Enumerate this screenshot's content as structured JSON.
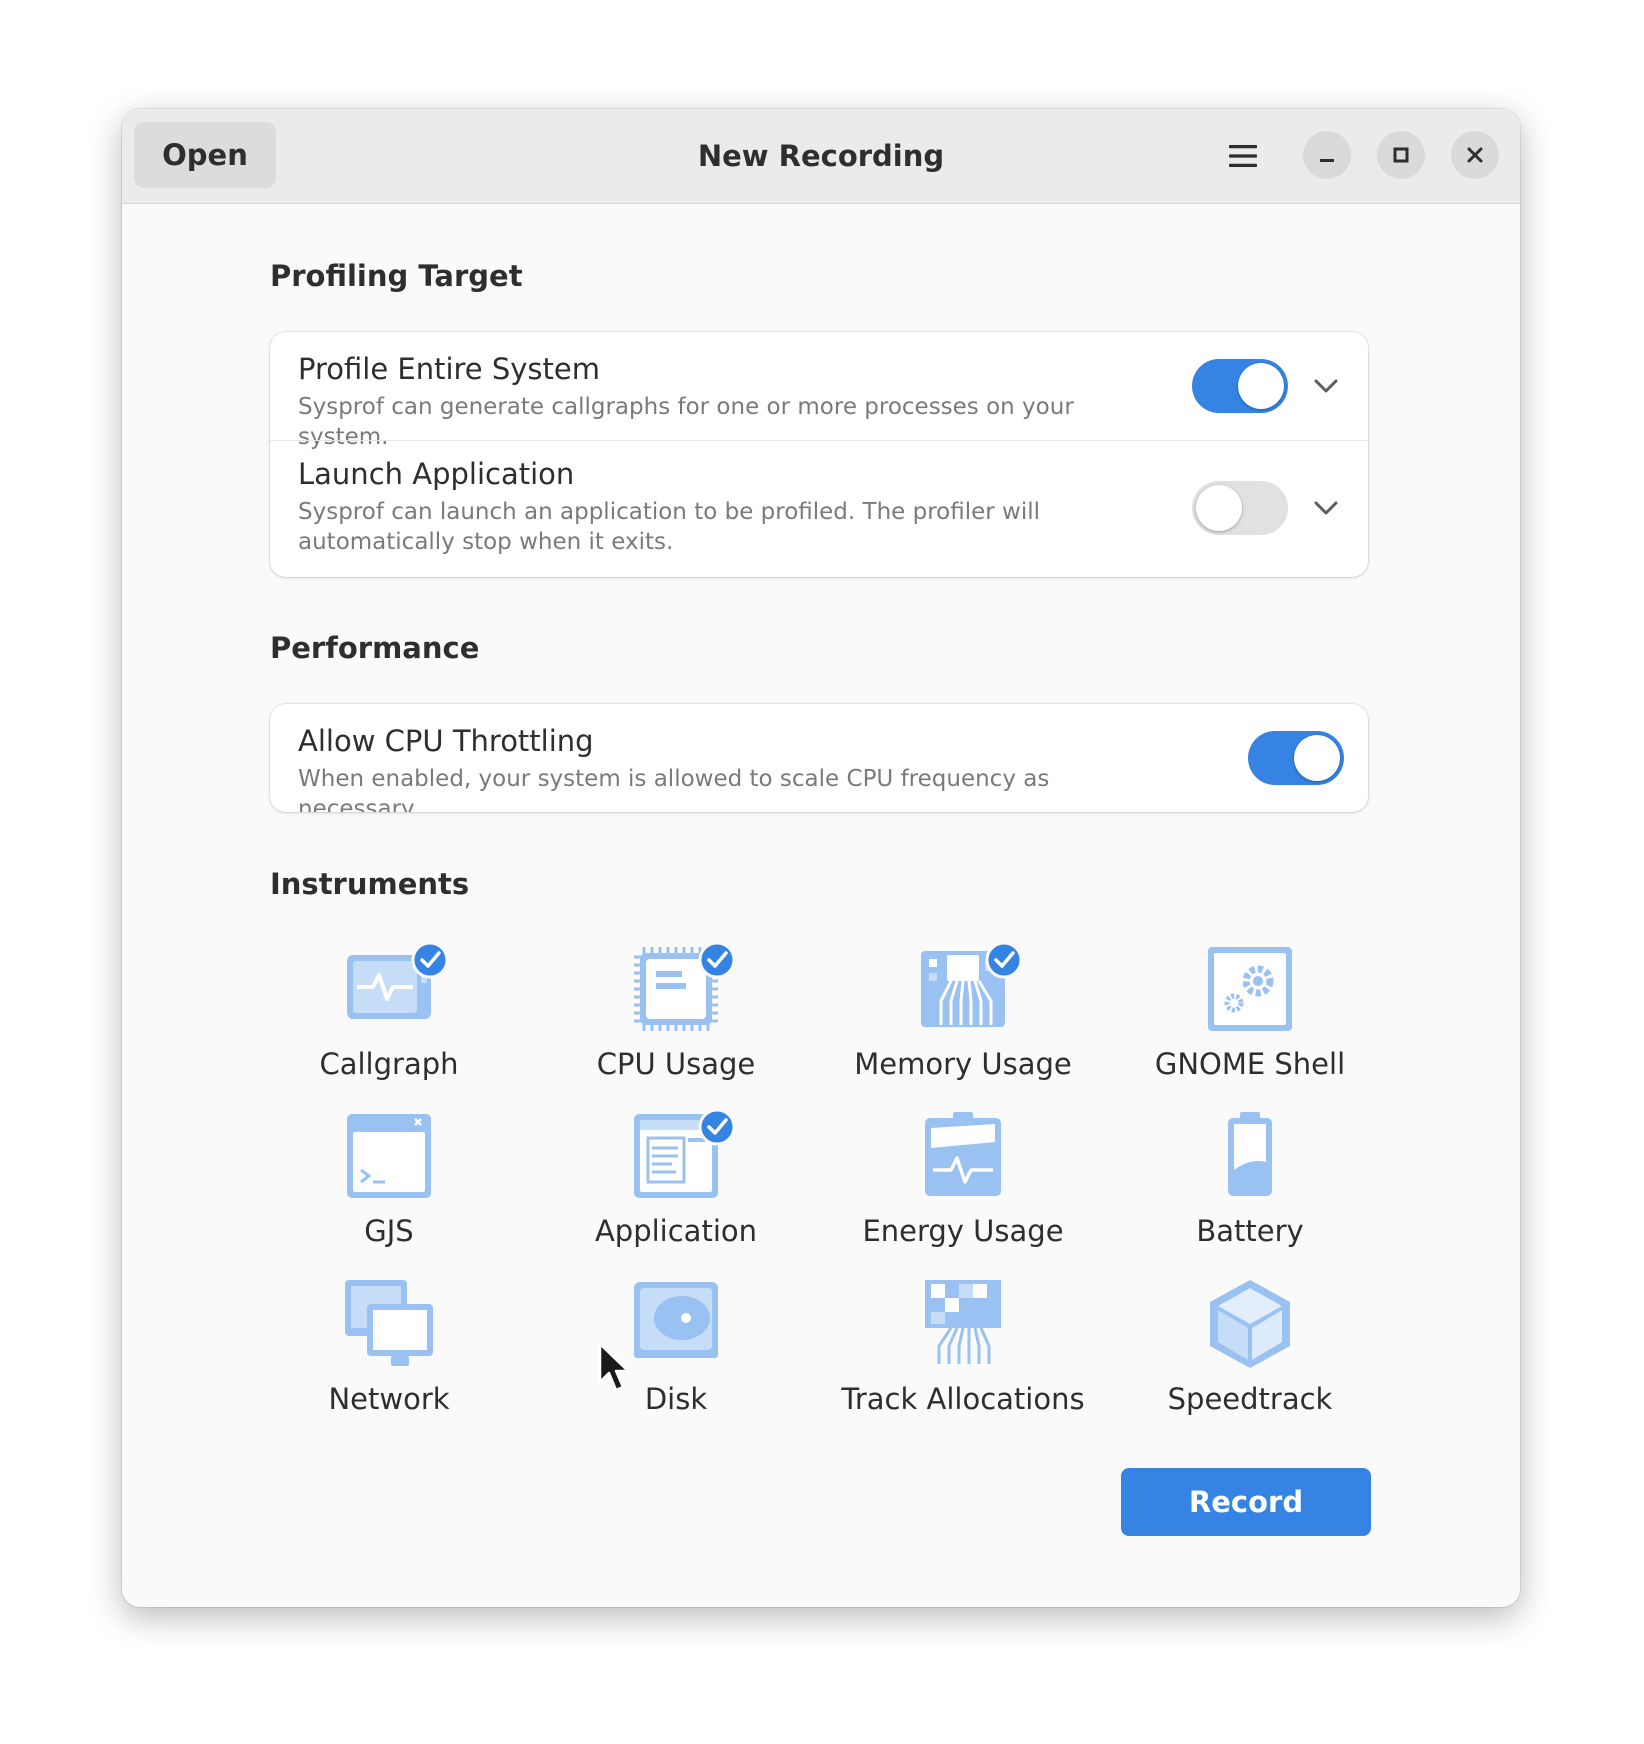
{
  "header": {
    "open_label": "Open",
    "title": "New Recording",
    "menu_icon": "hamburger-menu-icon",
    "minimize_icon": "minimize-icon",
    "maximize_icon": "maximize-icon",
    "close_icon": "close-icon"
  },
  "profiling_target": {
    "title": "Profiling Target",
    "rows": [
      {
        "title": "Profile Entire System",
        "subtitle": "Sysprof can generate callgraphs for one or more processes on your system.",
        "enabled": true
      },
      {
        "title": "Launch Application",
        "subtitle": "Sysprof can launch an application to be profiled. The profiler will automatically stop when it exits.",
        "enabled": false
      }
    ]
  },
  "performance": {
    "title": "Performance",
    "rows": [
      {
        "title": "Allow CPU Throttling",
        "subtitle": "When enabled, your system is allowed to scale CPU frequency as necessary.",
        "enabled": true
      }
    ]
  },
  "instruments": {
    "title": "Instruments",
    "items": [
      {
        "label": "Callgraph",
        "icon": "callgraph-icon",
        "selected": true
      },
      {
        "label": "CPU Usage",
        "icon": "cpu-icon",
        "selected": true
      },
      {
        "label": "Memory Usage",
        "icon": "memory-icon",
        "selected": true
      },
      {
        "label": "GNOME Shell",
        "icon": "gnome-shell-icon",
        "selected": false
      },
      {
        "label": "GJS",
        "icon": "terminal-icon",
        "selected": false
      },
      {
        "label": "Application",
        "icon": "application-icon",
        "selected": true
      },
      {
        "label": "Energy Usage",
        "icon": "energy-icon",
        "selected": false
      },
      {
        "label": "Battery",
        "icon": "battery-icon",
        "selected": false
      },
      {
        "label": "Network",
        "icon": "network-icon",
        "selected": false
      },
      {
        "label": "Disk",
        "icon": "disk-icon",
        "selected": false
      },
      {
        "label": "Track Allocations",
        "icon": "allocations-icon",
        "selected": false
      },
      {
        "label": "Speedtrack",
        "icon": "speedtrack-icon",
        "selected": false
      }
    ]
  },
  "record_label": "Record",
  "colors": {
    "accent": "#3584e4",
    "icon_blue": "#99c1f1"
  }
}
